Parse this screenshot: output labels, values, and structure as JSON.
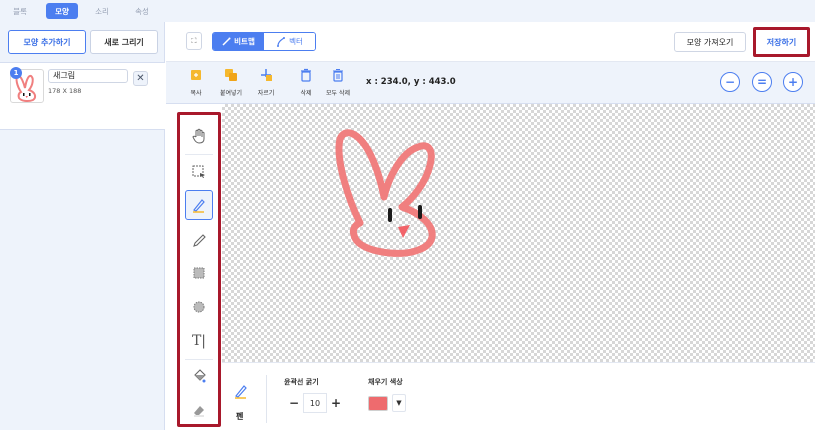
{
  "top_tabs": [
    {
      "label": "블록"
    },
    {
      "label": "모양"
    },
    {
      "label": "소리"
    },
    {
      "label": "속성"
    }
  ],
  "sidebar": {
    "add_costume_label": "모양 추가하기",
    "new_drawing_label": "새로 그리기",
    "costume": {
      "index": "1",
      "name": "새그림",
      "size": "178 X 188",
      "delete_glyph": "✕"
    }
  },
  "toolbar": {
    "fullscreen_glyph": "⛶",
    "bitmap_label": "비트맵",
    "vector_label": "벡터",
    "import_label": "모양 가져오기",
    "save_label": "저장하기"
  },
  "edit_tools": {
    "copy_label": "복사",
    "paste_label": "붙여넣기",
    "cut_label": "자르기",
    "delete_label": "삭제",
    "delete_all_label": "모두 삭제",
    "coords": "x : 234.0, y : 443.0",
    "zoom_out": "−",
    "zoom_reset": "=",
    "zoom_in": "+"
  },
  "palette": {
    "tools": [
      "hand-icon",
      "select-icon",
      "pen-icon",
      "pencil-icon",
      "rect-select-icon",
      "circle-select-icon",
      "text-icon",
      "fill-icon",
      "eraser-icon"
    ],
    "active_tool": "pen-icon",
    "text_glyph": "T|"
  },
  "options": {
    "tool_name": "펜",
    "outline_width_label": "윤곽선 굵기",
    "outline_width_value": "10",
    "minus": "−",
    "plus": "+",
    "fill_color_label": "채우기 색상",
    "fill_color": "#ee6b6e",
    "dropdown_glyph": "▼"
  },
  "colors": {
    "accent": "#4c7ef0",
    "highlight_border": "#a8182b",
    "drawing_stroke": "#f07f7f",
    "nose": "#f2646a"
  }
}
